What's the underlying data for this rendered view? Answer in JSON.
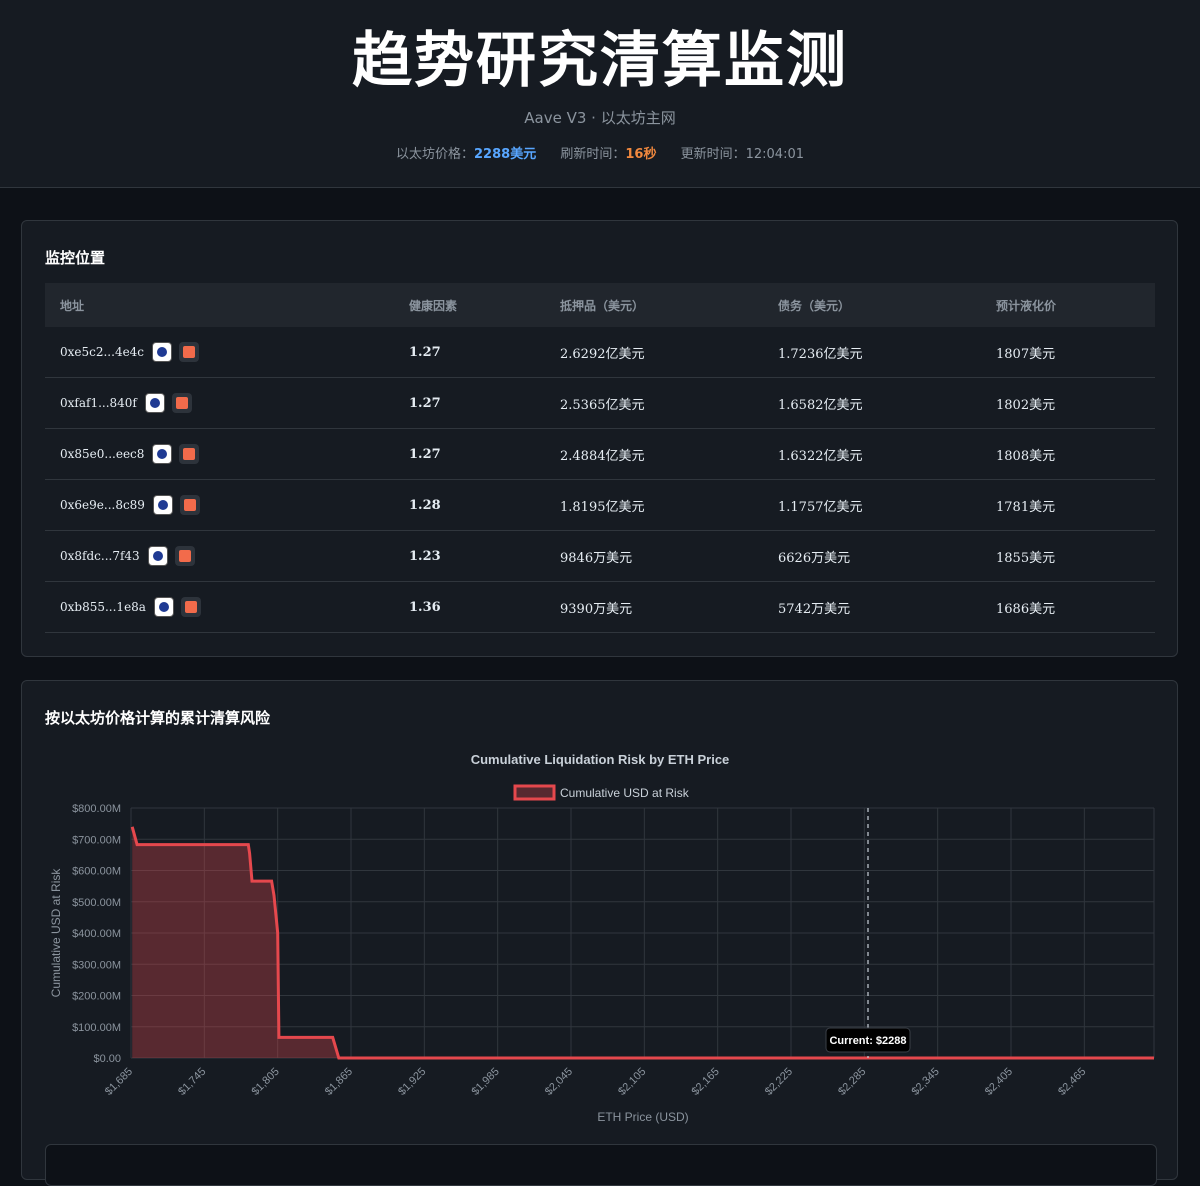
{
  "header": {
    "title": "趋势研究清算监测",
    "subtitle": "Aave V3 · 以太坊主网",
    "eth_price_label": "以太坊价格：",
    "eth_price_value": "2288美元",
    "refresh_label": "刷新时间：",
    "refresh_value": "16秒",
    "updated_label": "更新时间：",
    "updated_value": "12:04:01"
  },
  "positions": {
    "title": "监控位置",
    "columns": [
      "地址",
      "健康因素",
      "抵押品（美元）",
      "债务（美元）",
      "预计液化价"
    ],
    "rows": [
      {
        "address": "0xe5c2...4e4c",
        "health": "1.27",
        "collateral": "2.6292亿美元",
        "debt": "1.7236亿美元",
        "liq_price": "1807美元"
      },
      {
        "address": "0xfaf1...840f",
        "health": "1.27",
        "collateral": "2.5365亿美元",
        "debt": "1.6582亿美元",
        "liq_price": "1802美元"
      },
      {
        "address": "0x85e0...eec8",
        "health": "1.27",
        "collateral": "2.4884亿美元",
        "debt": "1.6322亿美元",
        "liq_price": "1808美元"
      },
      {
        "address": "0x6e9e...8c89",
        "health": "1.28",
        "collateral": "1.8195亿美元",
        "debt": "1.1757亿美元",
        "liq_price": "1781美元"
      },
      {
        "address": "0x8fdc...7f43",
        "health": "1.23",
        "collateral": "9846万美元",
        "debt": "6626万美元",
        "liq_price": "1855美元"
      },
      {
        "address": "0xb855...1e8a",
        "health": "1.36",
        "collateral": "9390万美元",
        "debt": "5742万美元",
        "liq_price": "1686美元"
      }
    ]
  },
  "risk": {
    "title": "按以太坊价格计算的累计清算风险"
  },
  "colors": {
    "line": "#e5484d",
    "fill": "rgba(229,72,77,0.32)",
    "grid": "#30363d",
    "axis_text": "#8b949e"
  },
  "chart_data": {
    "type": "area",
    "title": "Cumulative Liquidation Risk by ETH Price",
    "xlabel": "ETH Price (USD)",
    "ylabel": "Cumulative USD at Risk",
    "legend": "top",
    "grid": true,
    "x_tick_labels": [
      "$1,685",
      "$1,745",
      "$1,805",
      "$1,865",
      "$1,925",
      "$1,985",
      "$2,045",
      "$2,105",
      "$2,165",
      "$2,225",
      "$2,285",
      "$2,345",
      "$2,405",
      "$2,465"
    ],
    "y_tick_labels": [
      "$0.00",
      "$100.00M",
      "$200.00M",
      "$300.00M",
      "$400.00M",
      "$500.00M",
      "$600.00M",
      "$700.00M",
      "$800.00M"
    ],
    "xlim": [
      1685,
      2522
    ],
    "ylim": [
      0,
      800
    ],
    "y_unit": "M USD",
    "series": [
      {
        "name": "Cumulative USD at Risk",
        "x": [
          1686,
          1690,
          1780,
          1781,
          1782,
          1784,
          1800,
          1802,
          1805,
          1806,
          1808,
          1850,
          1855,
          1856,
          2522
        ],
        "y": [
          740,
          683,
          683,
          683,
          655,
          566,
          566,
          520,
          400,
          66,
          66,
          66,
          0,
          0,
          0
        ]
      }
    ],
    "current_marker": {
      "x": 2288,
      "label": "Current: $2288"
    }
  }
}
